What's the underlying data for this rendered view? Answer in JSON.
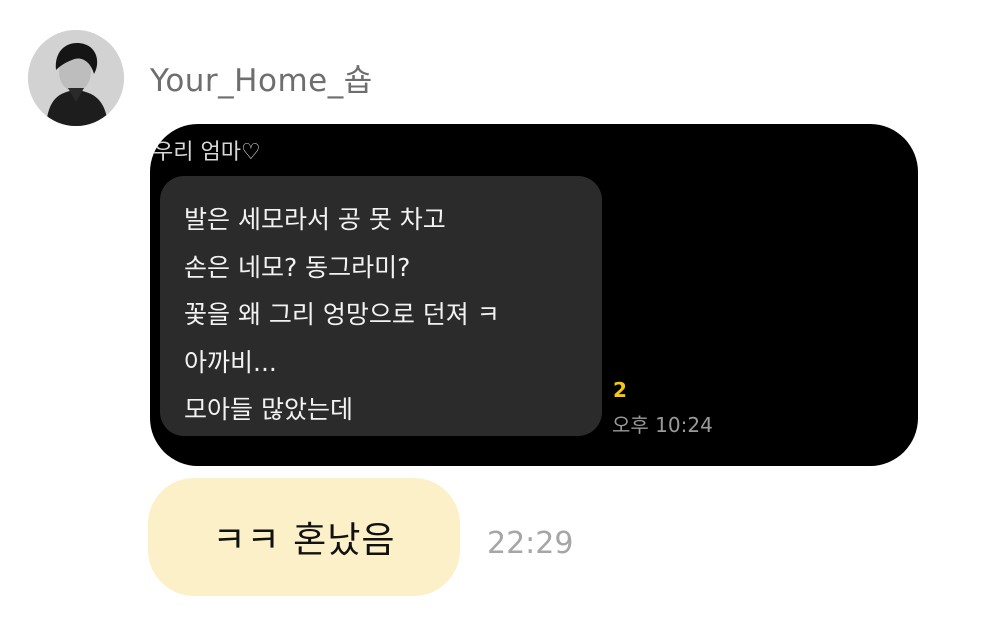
{
  "message": {
    "sender_name": "Your_Home_숍",
    "shared_image": {
      "contact_name": "우리 엄마♡",
      "lines": [
        "발은 세모라서 공 못 차고",
        "손은 네모? 동그라미?",
        "꽃을 왜 그리 엉망으로 던져 ㅋ",
        "아까비...",
        "모아들 많았는데"
      ],
      "unread_count": "2",
      "time": "오후 10:24"
    }
  },
  "reply": {
    "text": "ㅋㅋ 혼났음",
    "time": "22:29",
    "bubble_color": "#fcf0c8"
  },
  "icons": {
    "avatar": "profile-photo"
  }
}
